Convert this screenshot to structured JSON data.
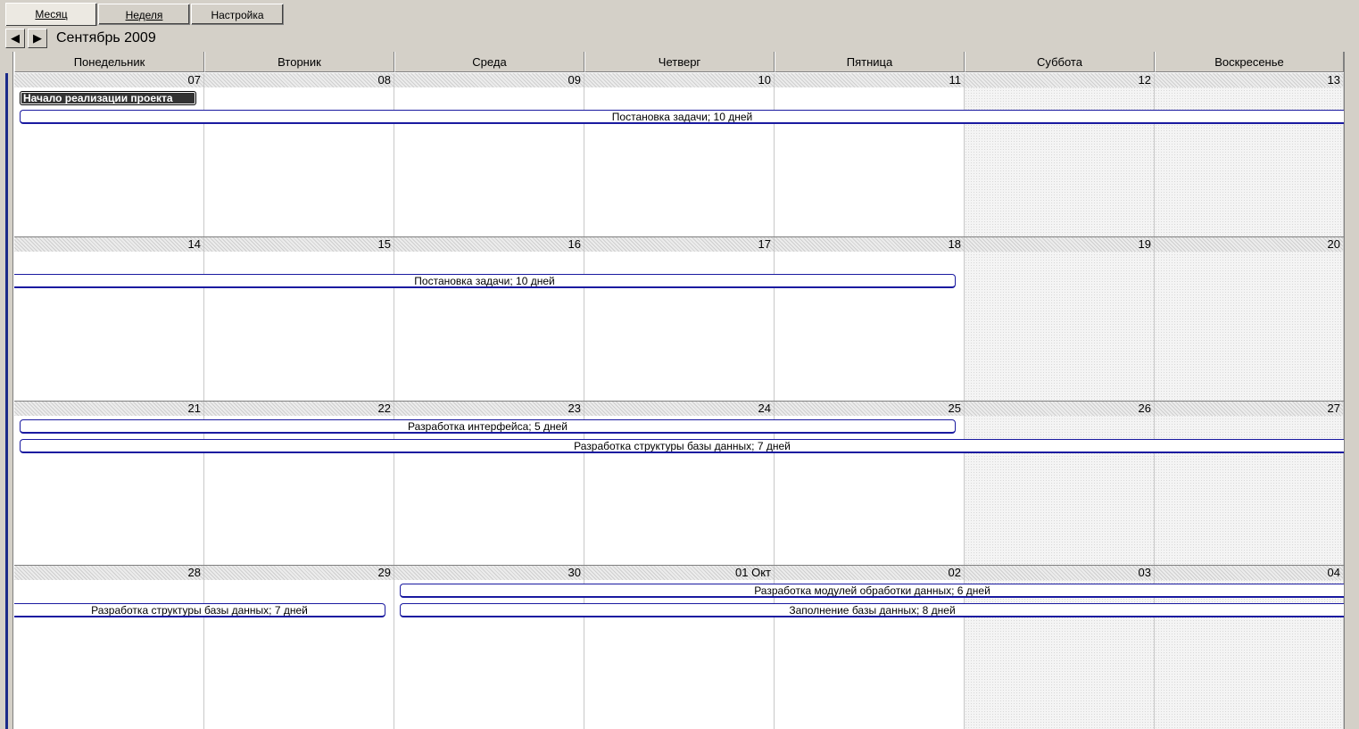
{
  "tabs": [
    {
      "label": "Месяц",
      "active": true
    },
    {
      "label": "Неделя",
      "active": false
    },
    {
      "label": "Настройка",
      "active": false
    }
  ],
  "nav": {
    "prev_icon": "triangle-left",
    "next_icon": "triangle-right",
    "month_title": "Сентябрь 2009"
  },
  "days": [
    "Понедельник",
    "Вторник",
    "Среда",
    "Четверг",
    "Пятница",
    "Суббота",
    "Воскресенье"
  ],
  "weeks": [
    {
      "dates": [
        "07",
        "08",
        "09",
        "10",
        "11",
        "12",
        "13"
      ]
    },
    {
      "dates": [
        "14",
        "15",
        "16",
        "17",
        "18",
        "19",
        "20"
      ]
    },
    {
      "dates": [
        "21",
        "22",
        "23",
        "24",
        "25",
        "26",
        "27"
      ]
    },
    {
      "dates": [
        "28",
        "29",
        "30",
        "01 Окт",
        "02",
        "03",
        "04"
      ]
    }
  ],
  "events": {
    "milestone": "Начало реализации проекта",
    "task_setup": "Постановка задачи; 10 дней",
    "ui_dev": "Разработка интерфейса; 5 дней",
    "db_struct": "Разработка структуры базы данных; 7 дней",
    "modules_dev": "Разработка модулей обработки данных; 6 дней",
    "db_fill": "Заполнение базы данных; 8 дней"
  },
  "colors": {
    "event_border": "#1a1aa0",
    "chrome": "#d4d0c8"
  }
}
